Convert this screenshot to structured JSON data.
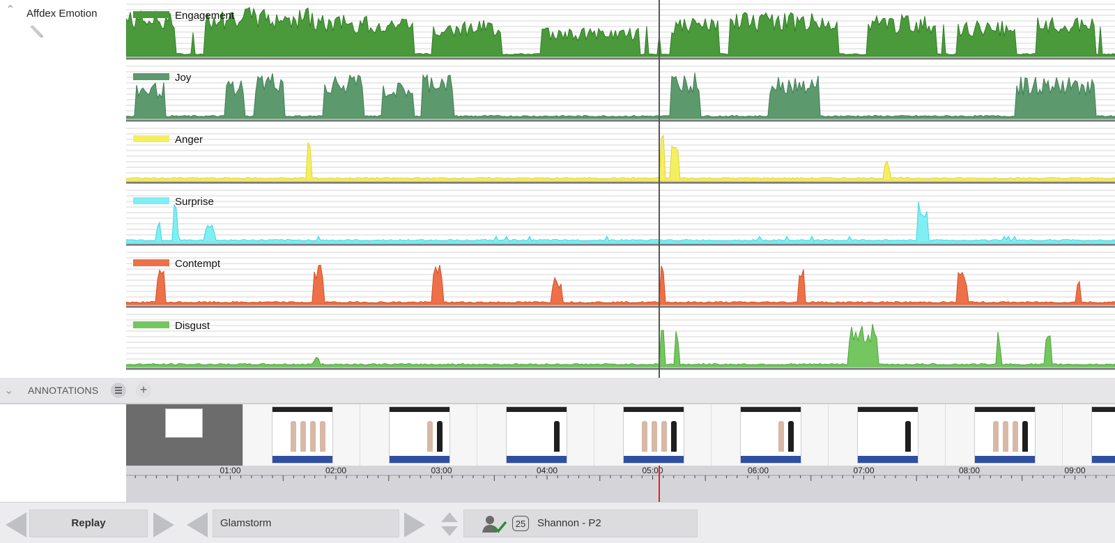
{
  "sensor": {
    "title": "Affdex Emotion",
    "collapse_icon": "chevron-up-icon",
    "edit_icon": "pencil-icon"
  },
  "tracks": [
    {
      "label": "Engagement",
      "color": "#4a9a3c",
      "stroke": "#2e7d22"
    },
    {
      "label": "Joy",
      "color": "#5c9a6e",
      "stroke": "#3d7d52"
    },
    {
      "label": "Anger",
      "color": "#f4ef62",
      "stroke": "#e0d52c"
    },
    {
      "label": "Surprise",
      "color": "#7feff4",
      "stroke": "#3fd6df"
    },
    {
      "label": "Contempt",
      "color": "#ee7048",
      "stroke": "#d44f22"
    },
    {
      "label": "Disgust",
      "color": "#74c660",
      "stroke": "#4aa838"
    }
  ],
  "annotations": {
    "title": "ANNOTATIONS",
    "collapse_icon": "chevron-down-icon",
    "menu_icon": "menu-icon",
    "add_label": "+"
  },
  "timeline": {
    "ticks": [
      "01:00",
      "02:00",
      "03:00",
      "04:00",
      "05:00",
      "06:00",
      "07:00",
      "08:00",
      "09:00"
    ],
    "playhead_color": "#e02020"
  },
  "toolbar": {
    "replay_label": "Replay",
    "study_name": "Glamstorm",
    "respondent_count": "25",
    "respondent_name": "Shannon - P2",
    "respondent_icon": "user-check-icon"
  }
}
